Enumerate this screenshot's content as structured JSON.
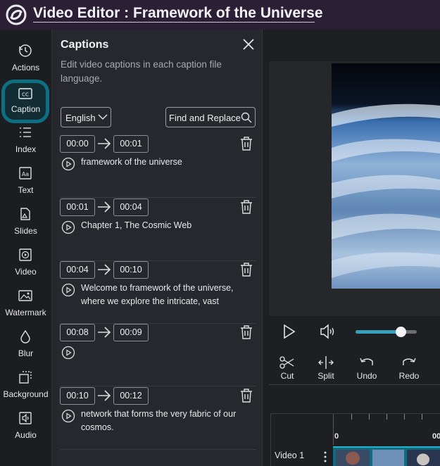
{
  "app": {
    "title": "Video Editor : Framework of the Universe"
  },
  "rail": {
    "items": [
      {
        "label": "Actions",
        "icon": "history-icon"
      },
      {
        "label": "Caption",
        "icon": "cc-icon",
        "active": true
      },
      {
        "label": "Index",
        "icon": "list-icon"
      },
      {
        "label": "Text",
        "icon": "text-box-icon"
      },
      {
        "label": "Slides",
        "icon": "slides-icon"
      },
      {
        "label": "Video",
        "icon": "video-file-icon"
      },
      {
        "label": "Watermark",
        "icon": "image-icon"
      },
      {
        "label": "Blur",
        "icon": "droplet-icon"
      },
      {
        "label": "Background",
        "icon": "background-icon"
      },
      {
        "label": "Audio",
        "icon": "audio-file-icon"
      }
    ]
  },
  "captions_panel": {
    "title": "Captions",
    "description": "Edit video captions in each caption file language.",
    "language": "English",
    "find_replace_label": "Find and Replace",
    "captions": [
      {
        "start": "00:00",
        "end": "00:01",
        "text": "framework of the universe"
      },
      {
        "start": "00:01",
        "end": "00:04",
        "text": "Chapter 1, The Cosmic Web"
      },
      {
        "start": "00:04",
        "end": "00:10",
        "text": "Welcome to framework of the universe, where we explore the intricate, vast"
      },
      {
        "start": "00:08",
        "end": "00:09",
        "text": ""
      },
      {
        "start": "00:10",
        "end": "00:12",
        "text": "network that forms the very fabric of our cosmos."
      }
    ]
  },
  "player": {
    "volume_fraction": 0.73,
    "tools": [
      {
        "label": "Cut",
        "icon": "scissors-icon"
      },
      {
        "label": "Split",
        "icon": "split-icon"
      },
      {
        "label": "Undo",
        "icon": "undo-icon"
      },
      {
        "label": "Redo",
        "icon": "redo-icon"
      }
    ]
  },
  "timeline": {
    "ruler_labels": [
      "0",
      "00"
    ],
    "track_label": "Video 1"
  },
  "colors": {
    "accent": "#0f6f82",
    "topbar": "#2b1f35",
    "panel": "#26282d",
    "slider_fill": "#35a0b8"
  }
}
